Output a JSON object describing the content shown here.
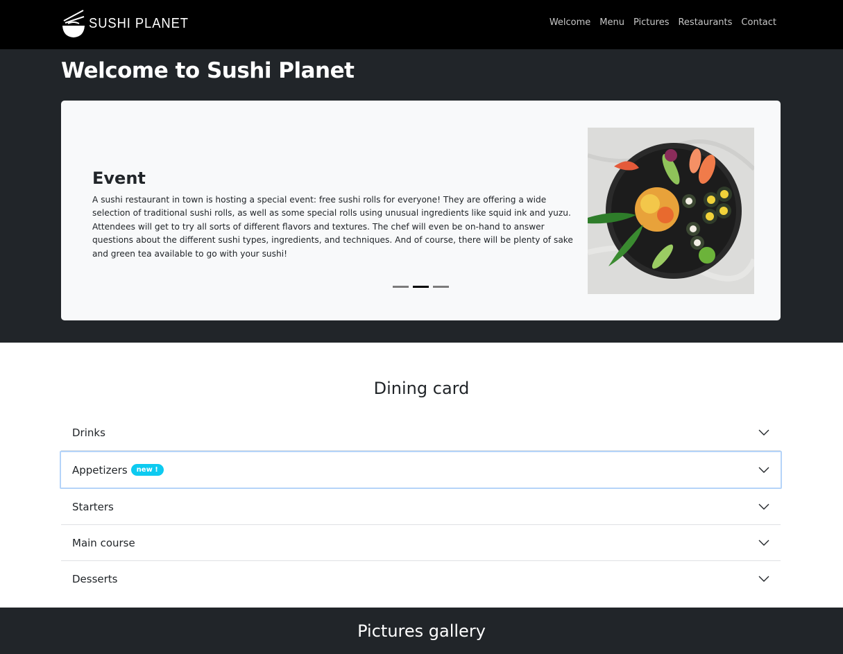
{
  "brand": {
    "name": "SUSHI PLANET",
    "logo_icon": "sushi-bowl-chopsticks-icon"
  },
  "nav": {
    "items": [
      "Welcome",
      "Menu",
      "Pictures",
      "Restaurants",
      "Contact"
    ]
  },
  "hero": {
    "title": "Welcome to Sushi Planet",
    "slide": {
      "title": "Event",
      "text": "A sushi restaurant in town is hosting a special event: free sushi rolls for everyone! They are offering a wide selection of traditional sushi rolls, as well as some special rolls using unusual ingredients like squid ink and yuzu. Attendees will get to try all sorts of different flavors and textures. The chef will even be on-hand to answer questions about the different sushi types, ingredients, and techniques. And of course, there will be plenty of sake and green tea available to go with your sushi!"
    },
    "indicators": {
      "count": 3,
      "active_index": 1
    }
  },
  "dining": {
    "title": "Dining card",
    "items": [
      {
        "label": "Drinks"
      },
      {
        "label": "Appetizers",
        "badge": "new !"
      },
      {
        "label": "Starters"
      },
      {
        "label": "Main course"
      },
      {
        "label": "Desserts"
      }
    ]
  },
  "gallery": {
    "title": "Pictures gallery"
  },
  "colors": {
    "navbar": "#000000",
    "hero_bg": "#212529",
    "card_bg": "#f8f9fa",
    "badge": "#0dcaf0",
    "focus_ring": "#b5d4f9"
  }
}
